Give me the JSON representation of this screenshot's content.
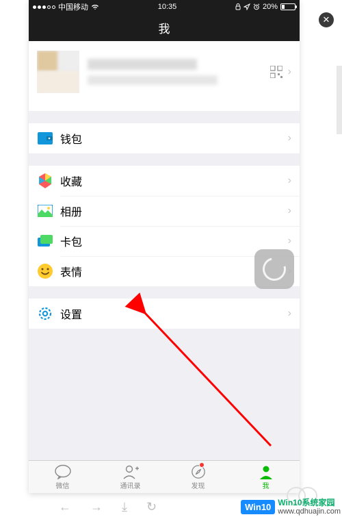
{
  "status": {
    "carrier": "中国移动",
    "time": "10:35",
    "battery_pct": "20%"
  },
  "nav": {
    "title": "我"
  },
  "menu": {
    "wallet": "钱包",
    "favorites": "收藏",
    "album": "相册",
    "cards": "卡包",
    "stickers": "表情",
    "settings": "设置"
  },
  "tabs": {
    "chats": "微信",
    "contacts": "通讯录",
    "discover": "发现",
    "me": "我"
  },
  "watermark": {
    "badge": "Win10",
    "line1": "Win10系统家园",
    "line2": "www.qdhuajin.com"
  }
}
